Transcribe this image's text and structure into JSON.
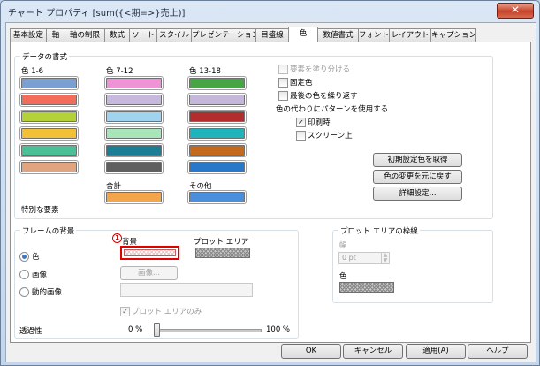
{
  "window": {
    "title": "チャート プロパティ [sum({<期=>}売上)]",
    "close_glyph": "✕"
  },
  "tabs": [
    {
      "label": "基本設定"
    },
    {
      "label": "軸"
    },
    {
      "label": "軸の制限"
    },
    {
      "label": "数式"
    },
    {
      "label": "ソート"
    },
    {
      "label": "スタイル"
    },
    {
      "label": "プレゼンテーション"
    },
    {
      "label": "目盛線"
    },
    {
      "label": "色"
    },
    {
      "label": "数値書式"
    },
    {
      "label": "フォント"
    },
    {
      "label": "レイアウト"
    },
    {
      "label": "キャプション"
    }
  ],
  "active_tab": "色",
  "data_format": {
    "title": "データの書式",
    "col1_label": "色 1-6",
    "col2_label": "色 7-12",
    "col3_label": "色 13-18",
    "col1_colors": [
      "#7c9fd2",
      "#f26b5b",
      "#b5d13a",
      "#f2c037",
      "#4bbf96",
      "#e0a57f"
    ],
    "col2_colors": [
      "#ee93d6",
      "#c7b8dd",
      "#9fd3f0",
      "#a8e6b9",
      "#1c7d94",
      "#5f5f5f"
    ],
    "col3_colors": [
      "#48a546",
      "#c4b7da",
      "#b32d2d",
      "#1fb3bb",
      "#c46a1f",
      "#2778c8"
    ],
    "total_label": "合計",
    "total_color": "#f4a44a",
    "other_label": "その他",
    "other_color": "#4a8fdb",
    "special_label": "特別な要素",
    "opt_fill_label": "要素を塗り分ける",
    "opt_fixed_label": "固定色",
    "opt_repeat_label": "最後の色を繰り返す",
    "pattern_label": "色の代わりにパターンを使用する",
    "opt_print_label": "印刷時",
    "opt_print_checked": true,
    "opt_screen_label": "スクリーン上",
    "btn_get_default": "初期設定色を取得",
    "btn_restore": "色の変更を元に戻す",
    "btn_advanced": "詳細設定..."
  },
  "frame_background": {
    "title": "フレームの背景",
    "radio_color": "色",
    "radio_image": "画像",
    "radio_dynamic": "動的画像",
    "selected": "色",
    "background_label": "背景",
    "plot_area_label": "プロット エリア",
    "image_button": "画像...",
    "plot_area_only_label": "プロット エリアのみ",
    "plot_area_only_checked": true,
    "transparency_label": "透過性",
    "transparency_min": "0 %",
    "transparency_max": "100 %",
    "transparency_value": 0,
    "annotation_marker": "1"
  },
  "plot_area_border": {
    "title": "プロット エリアの枠線",
    "width_label": "幅",
    "width_value": "0 pt",
    "color_label": "色"
  },
  "buttons": {
    "ok": "OK",
    "cancel": "キャンセル",
    "apply": "適用(A)",
    "help": "ヘルプ"
  }
}
